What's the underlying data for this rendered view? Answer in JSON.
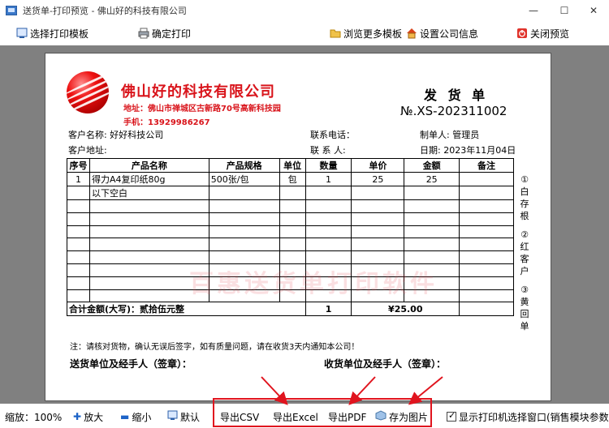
{
  "window": {
    "title": "送货单-打印预览 - 佛山好的科技有限公司",
    "min_icon": "—",
    "max_icon": "☐",
    "close_icon": "✕"
  },
  "toolbar": {
    "select_template": "选择打印模板",
    "confirm_print": "确定打印",
    "browse_templates": "浏览更多模板",
    "company_settings": "设置公司信息",
    "close_preview": "关闭预览"
  },
  "document": {
    "company_name": "佛山好的科技有限公司",
    "address": "地址：佛山市禅城区古新路70号高新科技园",
    "phone": "手机：13929986267",
    "title": "发 货 单",
    "number": "№.XS-202311002",
    "customer_name_label": "客户名称:",
    "customer_name": "好好科技公司",
    "contact_phone_label": "联系电话：",
    "maker_label": "制单人:",
    "maker": "管理员",
    "customer_address_label": "客户地址:",
    "contact_person_label": "联 系 人:",
    "date_label": "日期:",
    "date": "2023年11月04日",
    "columns": [
      "序号",
      "产品名称",
      "产品规格",
      "单位",
      "数量",
      "单价",
      "金额",
      "备注"
    ],
    "rows": [
      [
        "1",
        "得力A4复印纸80g",
        "500张/包",
        "包",
        "1",
        "25",
        "25",
        ""
      ],
      [
        "",
        "以下空白",
        "",
        "",
        "",
        "",
        "",
        ""
      ]
    ],
    "empty_row_count": 8,
    "total_label": "合计金额(大写)：贰拾伍元整",
    "total_qty": "1",
    "total_amount": "¥25.00",
    "side_copies": [
      "①",
      "白",
      "存",
      "根",
      "",
      "②",
      "红",
      "客",
      "户",
      "",
      "③",
      "黄",
      "回",
      "单"
    ],
    "note": "注：请核对货物，确认无误后签字，如有质量问题，请在收货3天内通知本公司！",
    "sender_sign": "送货单位及经手人（签章）：",
    "receiver_sign": "收货单位及经手人（签章）：",
    "watermark": "百惠送货单打印软件"
  },
  "bottom": {
    "zoom_label": "缩放：100%",
    "zoom_in": "放大",
    "zoom_out": "缩小",
    "default": "默认",
    "export_csv": "导出CSV",
    "export_excel": "导出Excel",
    "export_pdf": "导出PDF",
    "save_image": "存为图片",
    "show_printer_dialog": "显示打印机选择窗口(销售模块参数)"
  },
  "colors": {
    "brand_red": "#d9141b",
    "highlight_red": "#e0141e",
    "workspace_gray": "#808080"
  },
  "icons": [
    "app-icon",
    "template-icon",
    "printer-icon",
    "folder-icon",
    "home-icon",
    "power-icon",
    "zoom-in-icon",
    "zoom-out-icon",
    "default-size-icon",
    "save-image-icon"
  ]
}
